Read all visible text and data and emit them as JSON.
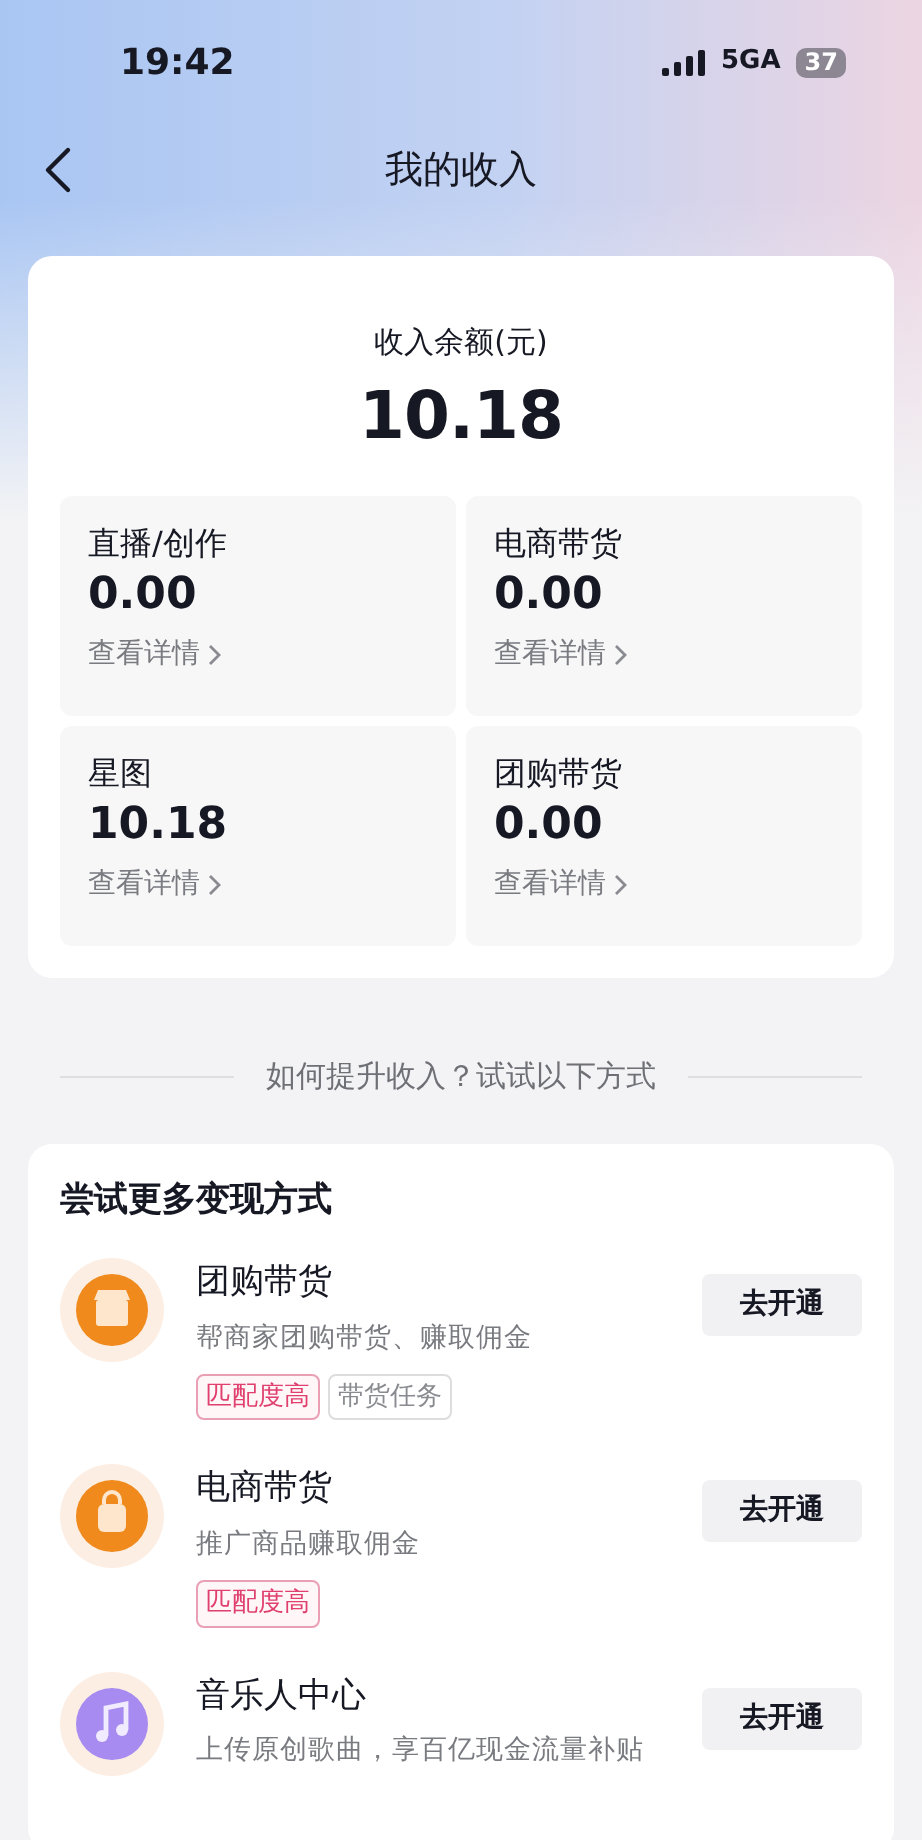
{
  "status_bar": {
    "time": "19:42",
    "network": "5GA",
    "battery": "37"
  },
  "nav": {
    "title": "我的收入"
  },
  "balance": {
    "label": "收入余额(元)",
    "amount": "10.18"
  },
  "tiles": [
    {
      "label": "直播/创作",
      "amount": "0.00",
      "link": "查看详情"
    },
    {
      "label": "电商带货",
      "amount": "0.00",
      "link": "查看详情"
    },
    {
      "label": "星图",
      "amount": "10.18",
      "link": "查看详情"
    },
    {
      "label": "团购带货",
      "amount": "0.00",
      "link": "查看详情"
    }
  ],
  "divider_text": "如何提升收入？试试以下方式",
  "methods": {
    "title": "尝试更多变现方式",
    "items": [
      {
        "kind": "shop",
        "title": "团购带货",
        "desc": "帮商家团购带货、赚取佣金",
        "tags": [
          {
            "text": "匹配度高",
            "kind": "highlight"
          },
          {
            "text": "带货任务",
            "kind": "plain"
          }
        ],
        "button": "去开通"
      },
      {
        "kind": "bag",
        "title": "电商带货",
        "desc": "推广商品赚取佣金",
        "tags": [
          {
            "text": "匹配度高",
            "kind": "highlight"
          }
        ],
        "button": "去开通"
      },
      {
        "kind": "music",
        "title": "音乐人中心",
        "desc": "上传原创歌曲，享百亿现金流量补贴",
        "button": "去开通"
      }
    ]
  }
}
